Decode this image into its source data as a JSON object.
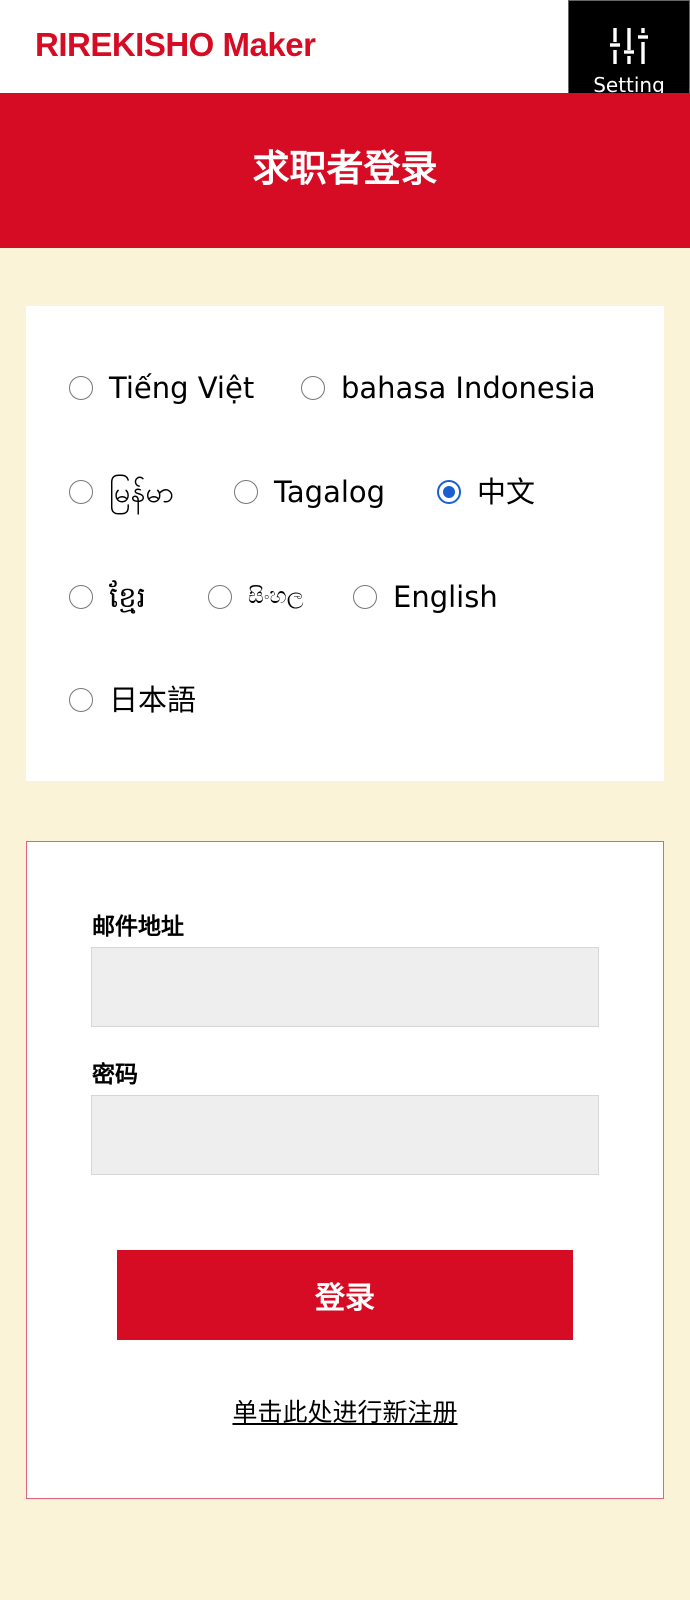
{
  "header": {
    "logo_text": "RIREKISHO Maker",
    "setting_label": "Setting",
    "setting_icon": "sliders-icon"
  },
  "title": "求职者登录",
  "languages": [
    {
      "label": "Tiếng Việt",
      "selected": false
    },
    {
      "label": "bahasa Indonesia",
      "selected": false
    },
    {
      "label": "မြန်မာ",
      "selected": false
    },
    {
      "label": "Tagalog",
      "selected": false
    },
    {
      "label": "中文",
      "selected": true
    },
    {
      "label": "ខ្មែរ",
      "selected": false
    },
    {
      "label": "සිංහල",
      "selected": false
    },
    {
      "label": "English",
      "selected": false
    },
    {
      "label": "日本語",
      "selected": false
    }
  ],
  "form": {
    "email_label": "邮件地址",
    "email_value": "",
    "password_label": "密码",
    "password_value": "",
    "login_button": "登录",
    "register_link": "单击此处进行新注册"
  },
  "colors": {
    "brand_red": "#d60c25",
    "page_background": "#faf3d7",
    "radio_selected": "#1a5fd0"
  }
}
